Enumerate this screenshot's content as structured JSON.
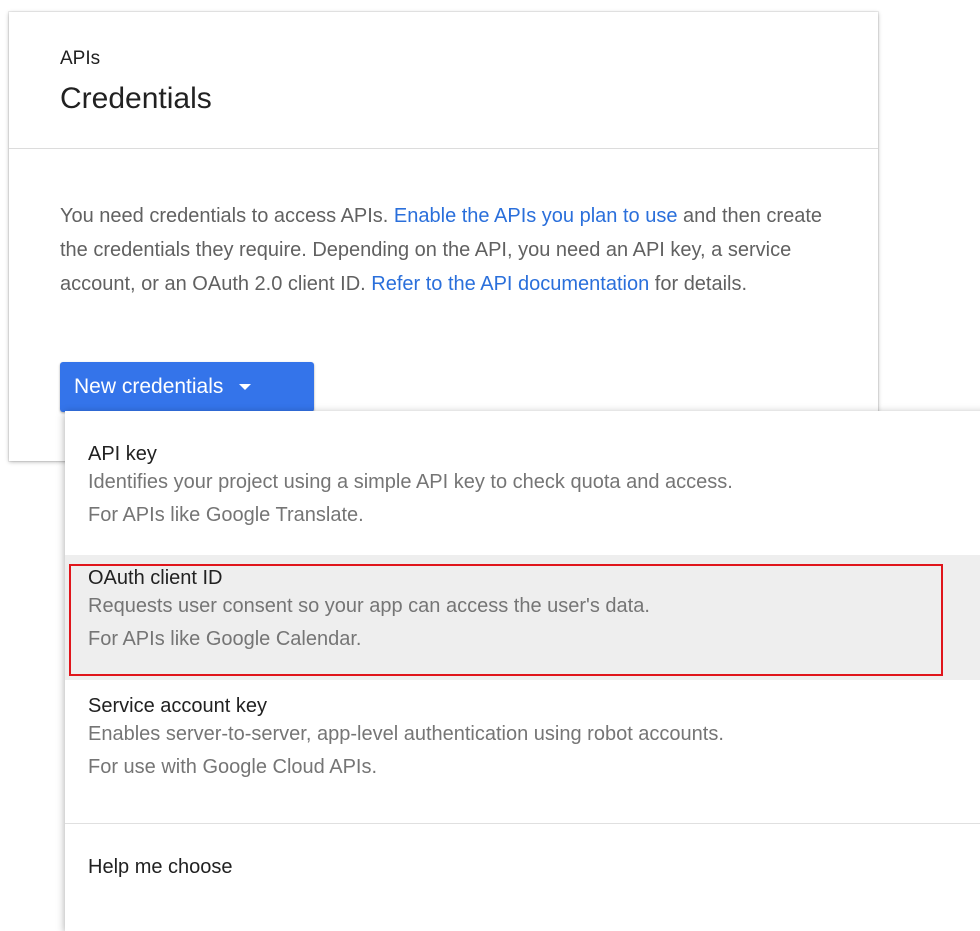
{
  "card": {
    "subtitle": "APIs",
    "title": "Credentials",
    "intro": {
      "text_1": "You need credentials to access APIs. ",
      "link_1": "Enable the APIs you plan to use",
      "text_2": " and then create the credentials they require. Depending on the API, you need an API key, a service account, or an OAuth 2.0 client ID. ",
      "link_2": "Refer to the API documentation",
      "text_3": " for details."
    },
    "new_credentials_label": "New credentials"
  },
  "menu": {
    "items": [
      {
        "label": "API key",
        "desc_1": "Identifies your project using a simple API key to check quota and access.",
        "desc_2": "For APIs like Google Translate."
      },
      {
        "label": "OAuth client ID",
        "desc_1": "Requests user consent so your app can access the user's data.",
        "desc_2": "For APIs like Google Calendar."
      },
      {
        "label": "Service account key",
        "desc_1": "Enables server-to-server, app-level authentication using robot accounts.",
        "desc_2": "For use with Google Cloud APIs."
      }
    ],
    "help_label": "Help me choose"
  },
  "colors": {
    "accent": "#3474ea",
    "link": "#2a6fdb",
    "highlight_border": "#e0151b",
    "hover_background": "#eeeeee"
  }
}
